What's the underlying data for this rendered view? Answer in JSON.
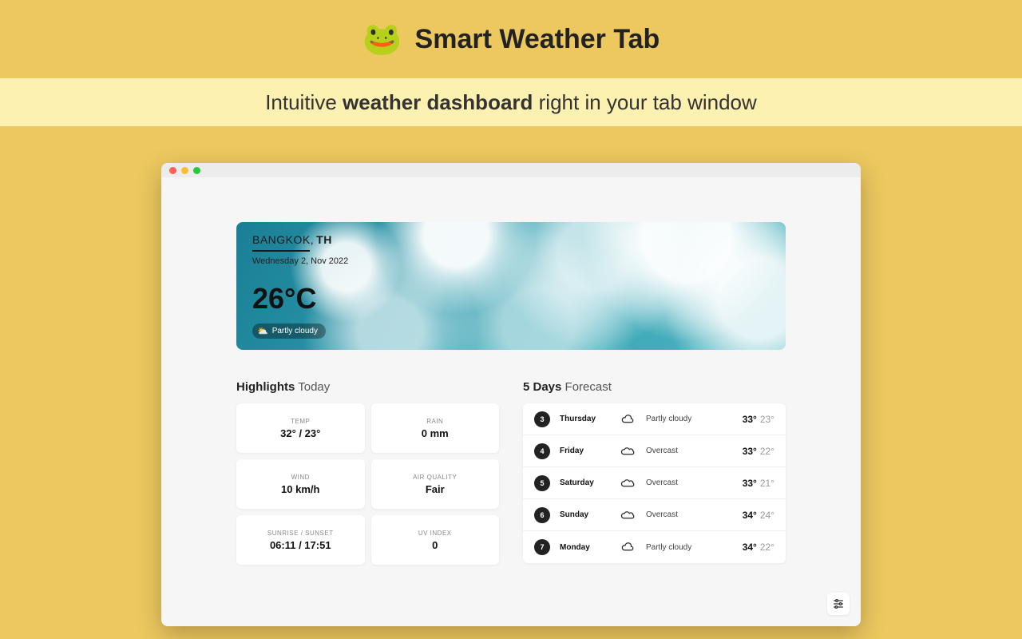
{
  "header": {
    "title": "Smart Weather Tab",
    "frog": "🐸"
  },
  "subtitle": {
    "pre": "Intuitive ",
    "bold": "weather dashboard",
    "post": " right in your tab window"
  },
  "hero": {
    "city": "BANGKOK,",
    "country": "TH",
    "date": "Wednesday 2, Nov 2022",
    "temp": "26°C",
    "condition": "Partly cloudy"
  },
  "highlights": {
    "title_strong": "Highlights",
    "title_light": "Today",
    "cards": [
      {
        "label": "TEMP",
        "value": "32° / 23°"
      },
      {
        "label": "RAIN",
        "value": "0 mm"
      },
      {
        "label": "WIND",
        "value": "10 km/h"
      },
      {
        "label": "AIR QUALITY",
        "value": "Fair"
      },
      {
        "label": "SUNRISE / SUNSET",
        "value": "06:11 / 17:51"
      },
      {
        "label": "UV INDEX",
        "value": "0"
      }
    ]
  },
  "forecast": {
    "title_strong": "5 Days",
    "title_light": "Forecast",
    "rows": [
      {
        "num": "3",
        "day": "Thursday",
        "icon": "partly",
        "cond": "Partly cloudy",
        "hi": "33°",
        "lo": "23°"
      },
      {
        "num": "4",
        "day": "Friday",
        "icon": "over",
        "cond": "Overcast",
        "hi": "33°",
        "lo": "22°"
      },
      {
        "num": "5",
        "day": "Saturday",
        "icon": "over",
        "cond": "Overcast",
        "hi": "33°",
        "lo": "21°"
      },
      {
        "num": "6",
        "day": "Sunday",
        "icon": "over",
        "cond": "Overcast",
        "hi": "34°",
        "lo": "24°"
      },
      {
        "num": "7",
        "day": "Monday",
        "icon": "partly",
        "cond": "Partly cloudy",
        "hi": "34°",
        "lo": "22°"
      }
    ]
  }
}
